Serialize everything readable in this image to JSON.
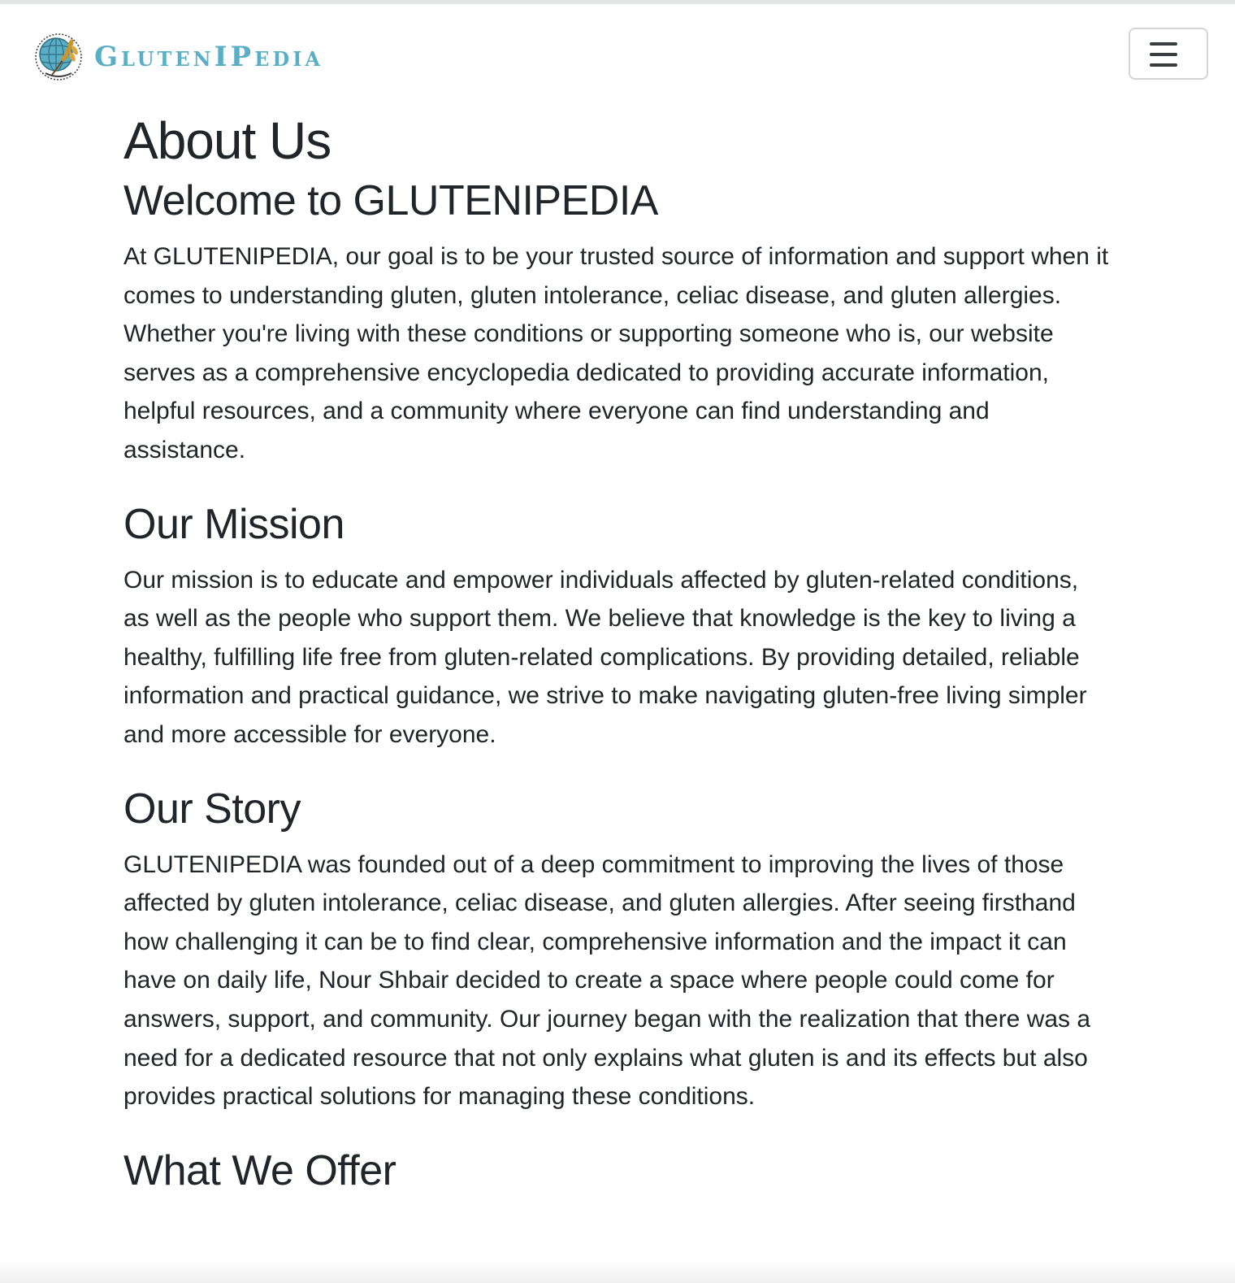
{
  "navbar": {
    "brand_text": "GlutenIPedia",
    "toggler_icon": "hamburger-menu-icon"
  },
  "page": {
    "title": "About Us",
    "sections": [
      {
        "heading": "Welcome to GLUTENIPEDIA",
        "body": "At GLUTENIPEDIA, our goal is to be your trusted source of information and support when it comes to understanding gluten, gluten intolerance, celiac disease, and gluten allergies. Whether you're living with these conditions or supporting someone who is, our website serves as a comprehensive encyclopedia dedicated to providing accurate information, helpful resources, and a community where everyone can find understanding and assistance."
      },
      {
        "heading": "Our Mission",
        "body": "Our mission is to educate and empower individuals affected by gluten-related conditions, as well as the people who support them. We believe that knowledge is the key to living a healthy, fulfilling life free from gluten-related complications. By providing detailed, reliable information and practical guidance, we strive to make navigating gluten-free living simpler and more accessible for everyone."
      },
      {
        "heading": "Our Story",
        "body": "GLUTENIPEDIA was founded out of a deep commitment to improving the lives of those affected by gluten intolerance, celiac disease, and gluten allergies. After seeing firsthand how challenging it can be to find clear, comprehensive information and the impact it can have on daily life, Nour Shbair decided to create a space where people could come for answers, support, and community. Our journey began with the realization that there was a need for a dedicated resource that not only explains what gluten is and its effects but also provides practical solutions for managing these conditions."
      },
      {
        "heading": "What We Offer"
      }
    ]
  },
  "colors": {
    "brand": "#5aaec5",
    "text": "#212529",
    "toggler_border": "#d3d5d8"
  }
}
